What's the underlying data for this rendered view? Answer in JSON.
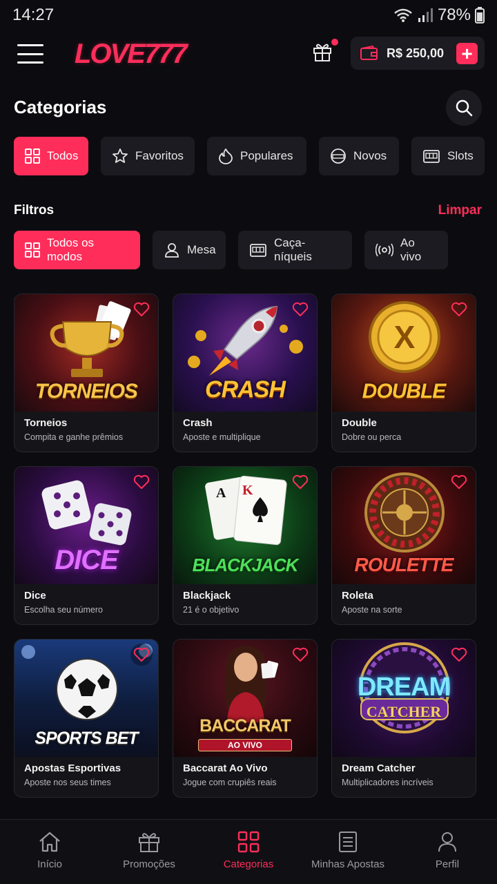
{
  "status_bar": {
    "time": "14:27",
    "battery": "78%"
  },
  "header": {
    "logo": "LOVE777",
    "balance": "R$ 250,00",
    "add_label": "+"
  },
  "categories": {
    "title": "Categorias",
    "chips": [
      {
        "label": "Todos",
        "icon": "grid-icon",
        "active": true
      },
      {
        "label": "Favoritos",
        "icon": "star-icon",
        "active": false
      },
      {
        "label": "Populares",
        "icon": "fire-icon",
        "active": false
      },
      {
        "label": "Novos",
        "icon": "new-badge-icon",
        "active": false
      },
      {
        "label": "Slots",
        "icon": "slot-machine-icon",
        "active": false
      }
    ]
  },
  "filters": {
    "title": "Filtros",
    "clear_label": "Limpar",
    "chips": [
      {
        "label": "Todos os modos",
        "icon": "grid-icon",
        "active": true
      },
      {
        "label": "Mesa",
        "icon": "dealer-icon",
        "active": false
      },
      {
        "label": "Caça-níqueis",
        "icon": "slot-machine-icon",
        "active": false
      },
      {
        "label": "Ao vivo",
        "icon": "broadcast-icon",
        "active": false
      }
    ]
  },
  "games": [
    {
      "art_text": "TORNEIOS",
      "name": "Torneios",
      "desc": "Compita e ganhe prêmios"
    },
    {
      "art_text": "CRASH",
      "name": "Crash",
      "desc": "Aposte e multiplique"
    },
    {
      "art_text": "DOUBLE",
      "name": "Double",
      "desc": "Dobre ou perca"
    },
    {
      "art_text": "DICE",
      "name": "Dice",
      "desc": "Escolha seu número"
    },
    {
      "art_text": "BLACKJACK",
      "name": "Blackjack",
      "desc": "21 é o objetivo"
    },
    {
      "art_text": "ROULETTE",
      "name": "Roleta",
      "desc": "Aposte na sorte"
    },
    {
      "art_text": "SPORTS BET",
      "name": "Apostas Esportivas",
      "desc": "Aposte nos seus times"
    },
    {
      "art_text": "BACCARAT",
      "art_sub": "AO VIVO",
      "name": "Baccarat Ao Vivo",
      "desc": "Jogue com crupiês reais"
    },
    {
      "art_text": "DREAM",
      "art_sub": "CATCHER",
      "name": "Dream Catcher",
      "desc": "Multiplicadores incríveis"
    }
  ],
  "bottom_nav": [
    {
      "label": "Início",
      "icon": "home-icon",
      "active": false
    },
    {
      "label": "Promoções",
      "icon": "gift-icon",
      "active": false
    },
    {
      "label": "Categorias",
      "icon": "grid-icon",
      "active": true
    },
    {
      "label": "Minhas Apostas",
      "icon": "receipt-icon",
      "active": false
    },
    {
      "label": "Perfil",
      "icon": "user-icon",
      "active": false
    }
  ],
  "colors": {
    "accent": "#ff2d5a",
    "background": "#0c0c10",
    "surface": "#1b1b21"
  }
}
